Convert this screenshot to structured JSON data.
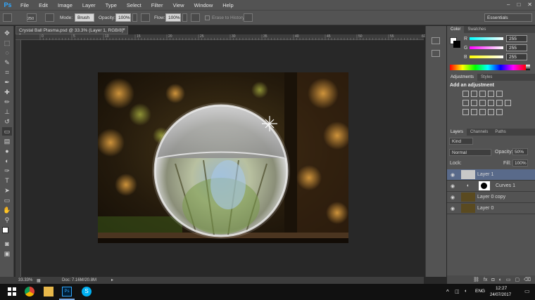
{
  "app": {
    "logo": "Ps"
  },
  "menu": [
    "File",
    "Edit",
    "Image",
    "Layer",
    "Type",
    "Select",
    "Filter",
    "View",
    "Window",
    "Help"
  ],
  "window_controls": [
    "–",
    "□",
    "✕"
  ],
  "options": {
    "brush_size": "250",
    "mode_label": "Mode:",
    "mode_value": "Brush",
    "opacity_label": "Opacity:",
    "opacity_value": "100%",
    "flow_label": "Flow:",
    "flow_value": "100%",
    "erase_history": "Erase to History",
    "workspace": "Essentials"
  },
  "document": {
    "tab_title": "Crystal Ball Plasma.psd @ 33.3% (Layer 1, RGB/8) *",
    "ruler_numbers": [
      "0",
      "5",
      "10",
      "15",
      "20",
      "25",
      "30",
      "35",
      "40",
      "45",
      "50",
      "55",
      "60"
    ]
  },
  "status": {
    "zoom": "33.33%",
    "doc": "Doc: 7.16M/20.8M"
  },
  "color_panel": {
    "tabs": [
      "Color",
      "Swatches"
    ],
    "channels": [
      {
        "label": "R",
        "value": "255"
      },
      {
        "label": "G",
        "value": "255"
      },
      {
        "label": "B",
        "value": "255"
      }
    ]
  },
  "adjustments_panel": {
    "tabs": [
      "Adjustments",
      "Styles"
    ],
    "heading": "Add an adjustment"
  },
  "layers_panel": {
    "tabs": [
      "Layers",
      "Channels",
      "Paths"
    ],
    "kind_label": "Kind",
    "blend_mode": "Normal",
    "opacity_label": "Opacity:",
    "opacity_value": "50%",
    "lock_label": "Lock:",
    "fill_label": "Fill:",
    "fill_value": "100%",
    "layers": [
      {
        "name": "Layer 1",
        "selected": true
      },
      {
        "name": "Curves 1",
        "selected": false
      },
      {
        "name": "Layer 0 copy",
        "selected": false
      },
      {
        "name": "Layer 0",
        "selected": false
      }
    ]
  },
  "taskbar": {
    "language": "ENG",
    "time": "12:27",
    "date": "24/07/2017",
    "chevron": "^"
  }
}
